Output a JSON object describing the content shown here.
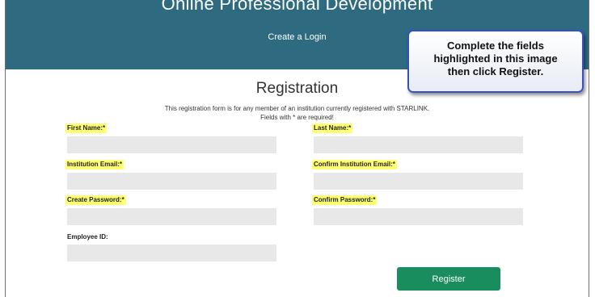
{
  "header": {
    "title": "Online Professional Development",
    "subtitle": "Create a Login",
    "background": "#2e6b80"
  },
  "callout": {
    "line1": "Complete the fields",
    "line2": "highlighted in this image",
    "line3": "then click Register."
  },
  "form": {
    "title": "Registration",
    "description_line1": "This registration form is for any member of an institution currently registered with STARLINK.",
    "description_line2": "Fields with * are required!",
    "fields": {
      "first_name": {
        "label": "First Name:*",
        "value": ""
      },
      "last_name": {
        "label": "Last Name:*",
        "value": ""
      },
      "institution_email": {
        "label": "Institution Email:*",
        "value": ""
      },
      "confirm_institution_email": {
        "label": "Confirm Institution Email:*",
        "value": ""
      },
      "create_password": {
        "label": "Create Password:*",
        "value": ""
      },
      "confirm_password": {
        "label": "Confirm Password:*",
        "value": ""
      },
      "employee_id": {
        "label": "Employee ID:",
        "value": ""
      }
    },
    "register_label": "Register"
  },
  "colors": {
    "highlight": "#ffff73",
    "input_bg": "#e8e8e8",
    "register_button": "#1a8d5f",
    "callout_border": "#3950c4"
  }
}
